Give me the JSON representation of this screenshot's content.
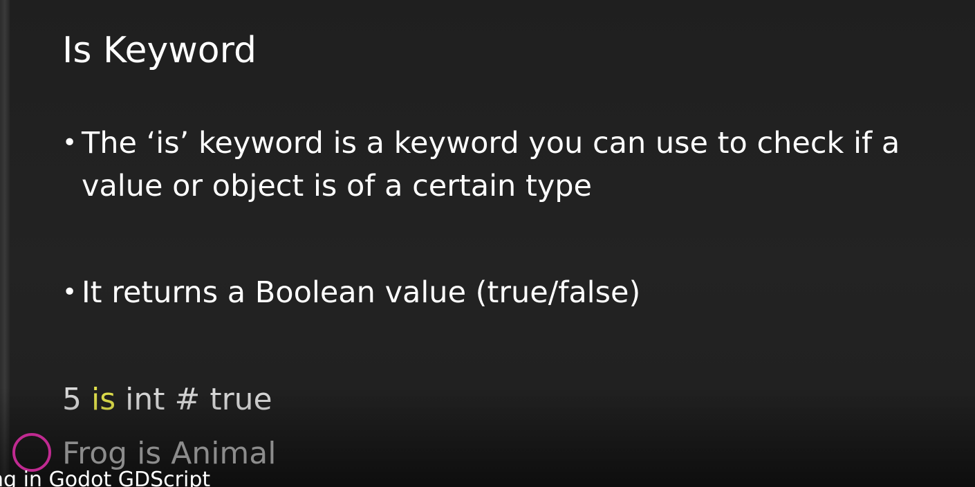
{
  "slide": {
    "title": "Is Keyword",
    "bullets": [
      {
        "line1": "The ‘is’ keyword is a keyword you can use to check if a",
        "line2": "value or object is of a certain type"
      },
      {
        "line1": "It returns a Boolean value (true/false)"
      }
    ],
    "examples": {
      "line1_prefix": "5 ",
      "line1_keyword": "is",
      "line1_suffix": " int # true",
      "line2": "Frog is Animal"
    },
    "bullet_glyph": "•"
  },
  "video_overlay": {
    "title_text": "ng in Godot GDScript"
  },
  "colors": {
    "background": "#202020",
    "text": "#ffffff",
    "keyword_highlight": "#e3e34d",
    "faded_text": "#8c8c8c",
    "cursor_ring": "#c02a91"
  }
}
